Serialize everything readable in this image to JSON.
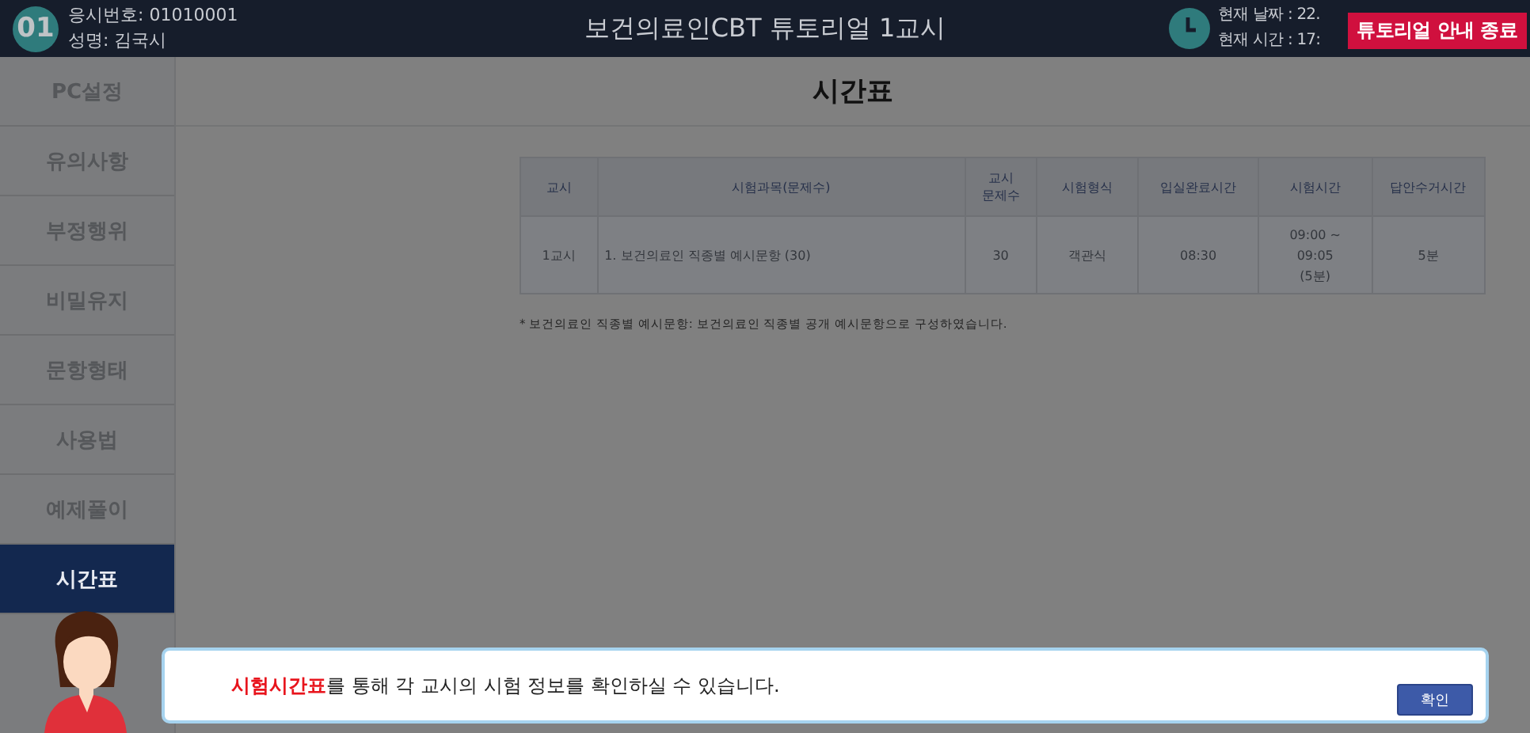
{
  "header": {
    "badge": "01",
    "exam_number": "응시번호: 01010001",
    "name": "성명: 김국시",
    "title": "보건의료인CBT 튜토리얼 1교시",
    "date": "현재 날짜 : 22.",
    "time": "현재 시간 : 17:",
    "end_button": "튜토리얼 안내 종료"
  },
  "sidebar": {
    "items": [
      {
        "label": "PC설정",
        "selected": false
      },
      {
        "label": "유의사항",
        "selected": false
      },
      {
        "label": "부정행위",
        "selected": false
      },
      {
        "label": "비밀유지",
        "selected": false
      },
      {
        "label": "문항형태",
        "selected": false
      },
      {
        "label": "사용법",
        "selected": false
      },
      {
        "label": "예제풀이",
        "selected": false
      },
      {
        "label": "시간표",
        "selected": true
      }
    ]
  },
  "page_title": "시간표",
  "table": {
    "columns": [
      "교시",
      "시험과목(문제수)",
      "교시\n문제수",
      "시험형식",
      "입실완료시간",
      "시험시간",
      "답안수거시간"
    ],
    "rows": [
      [
        "1교시",
        "1. 보건의료인 직종별 예시문항 (30)",
        "30",
        "객관식",
        "08:30",
        "09:00 ~\n09:05\n(5분)",
        "5분"
      ]
    ]
  },
  "footnote": "* 보건의료인 직종별 예시문항: 보건의료인 직종별 공개 예시문항으로 구성하였습니다.",
  "popup": {
    "message": "**시험시간표**를 통해 각 교시의 시험 정보를 확인하실 수 있습니다.",
    "button": "확인"
  }
}
